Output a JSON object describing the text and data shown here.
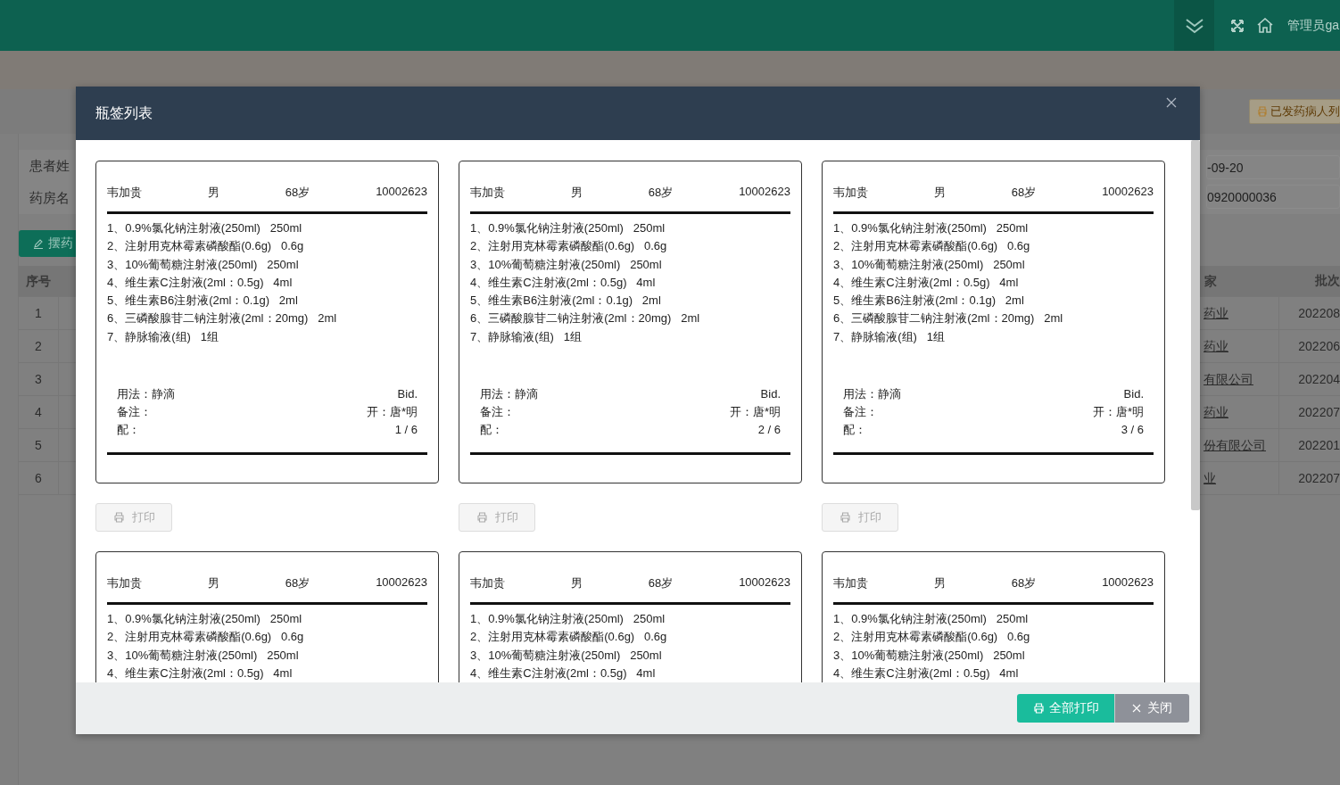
{
  "header": {
    "user": "管理员ga"
  },
  "toolbar": {
    "button": "已发药病人列"
  },
  "form": {
    "left_labels": [
      "患者姓",
      "药房名"
    ],
    "right_values": [
      "-09-20",
      "0920000036"
    ]
  },
  "action_button": "摆药",
  "table": {
    "left_header": "序号",
    "right_headers": [
      "家",
      "批次"
    ],
    "rows": [
      {
        "index": "1",
        "vendor": "药业",
        "batch": "202208"
      },
      {
        "index": "2",
        "vendor": "药业",
        "batch": "202206"
      },
      {
        "index": "3",
        "vendor": "有限公司",
        "batch": "202204"
      },
      {
        "index": "4",
        "vendor": "药业",
        "batch": "202207"
      },
      {
        "index": "5",
        "vendor": "份有限公司",
        "batch": "202201"
      },
      {
        "index": "6",
        "vendor": "业",
        "batch": "202207"
      }
    ]
  },
  "dialog": {
    "title": "瓶签列表",
    "labels": [
      {
        "patient": "韦加贵",
        "gender": "男",
        "age": "68岁",
        "number": "10002623",
        "items": [
          "1、0.9%氯化钠注射液(250ml)   250ml",
          "2、注射用克林霉素磷酸酯(0.6g)   0.6g",
          "3、10%葡萄糖注射液(250ml)   250ml",
          "4、维生素C注射液(2ml：0.5g)   4ml",
          "5、维生素B6注射液(2ml：0.1g)   2ml",
          "6、三磷酸腺苷二钠注射液(2ml：20mg)   2ml",
          "7、静脉输液(组)   1组"
        ],
        "usage": "用法：静滴",
        "frequency": "Bid.",
        "remark": "备注：",
        "prescriber": "开：唐*明",
        "dispenser": "配：",
        "page": "1 / 6",
        "print": {
          "label": "打印",
          "disabled": true
        }
      },
      {
        "patient": "韦加贵",
        "gender": "男",
        "age": "68岁",
        "number": "10002623",
        "items": [
          "1、0.9%氯化钠注射液(250ml)   250ml",
          "2、注射用克林霉素磷酸酯(0.6g)   0.6g",
          "3、10%葡萄糖注射液(250ml)   250ml",
          "4、维生素C注射液(2ml：0.5g)   4ml",
          "5、维生素B6注射液(2ml：0.1g)   2ml",
          "6、三磷酸腺苷二钠注射液(2ml：20mg)   2ml",
          "7、静脉输液(组)   1组"
        ],
        "usage": "用法：静滴",
        "frequency": "Bid.",
        "remark": "备注：",
        "prescriber": "开：唐*明",
        "dispenser": "配：",
        "page": "2 / 6",
        "print": {
          "label": "打印",
          "disabled": true
        }
      },
      {
        "patient": "韦加贵",
        "gender": "男",
        "age": "68岁",
        "number": "10002623",
        "items": [
          "1、0.9%氯化钠注射液(250ml)   250ml",
          "2、注射用克林霉素磷酸酯(0.6g)   0.6g",
          "3、10%葡萄糖注射液(250ml)   250ml",
          "4、维生素C注射液(2ml：0.5g)   4ml",
          "5、维生素B6注射液(2ml：0.1g)   2ml",
          "6、三磷酸腺苷二钠注射液(2ml：20mg)   2ml",
          "7、静脉输液(组)   1组"
        ],
        "usage": "用法：静滴",
        "frequency": "Bid.",
        "remark": "备注：",
        "prescriber": "开：唐*明",
        "dispenser": "配：",
        "page": "3 / 6",
        "print": {
          "label": "打印",
          "disabled": true
        }
      },
      {
        "patient": "韦加贵",
        "gender": "男",
        "age": "68岁",
        "number": "10002623",
        "items": [
          "1、0.9%氯化钠注射液(250ml)   250ml",
          "2、注射用克林霉素磷酸酯(0.6g)   0.6g",
          "3、10%葡萄糖注射液(250ml)   250ml",
          "4、维生素C注射液(2ml：0.5g)   4ml"
        ]
      },
      {
        "patient": "韦加贵",
        "gender": "男",
        "age": "68岁",
        "number": "10002623",
        "items": [
          "1、0.9%氯化钠注射液(250ml)   250ml",
          "2、注射用克林霉素磷酸酯(0.6g)   0.6g",
          "3、10%葡萄糖注射液(250ml)   250ml",
          "4、维生素C注射液(2ml：0.5g)   4ml"
        ]
      },
      {
        "patient": "韦加贵",
        "gender": "男",
        "age": "68岁",
        "number": "10002623",
        "items": [
          "1、0.9%氯化钠注射液(250ml)   250ml",
          "2、注射用克林霉素磷酸酯(0.6g)   0.6g",
          "3、10%葡萄糖注射液(250ml)   250ml",
          "4、维生素C注射液(2ml：0.5g)   4ml"
        ]
      }
    ],
    "print_all": "全部打印",
    "close": "关闭"
  }
}
